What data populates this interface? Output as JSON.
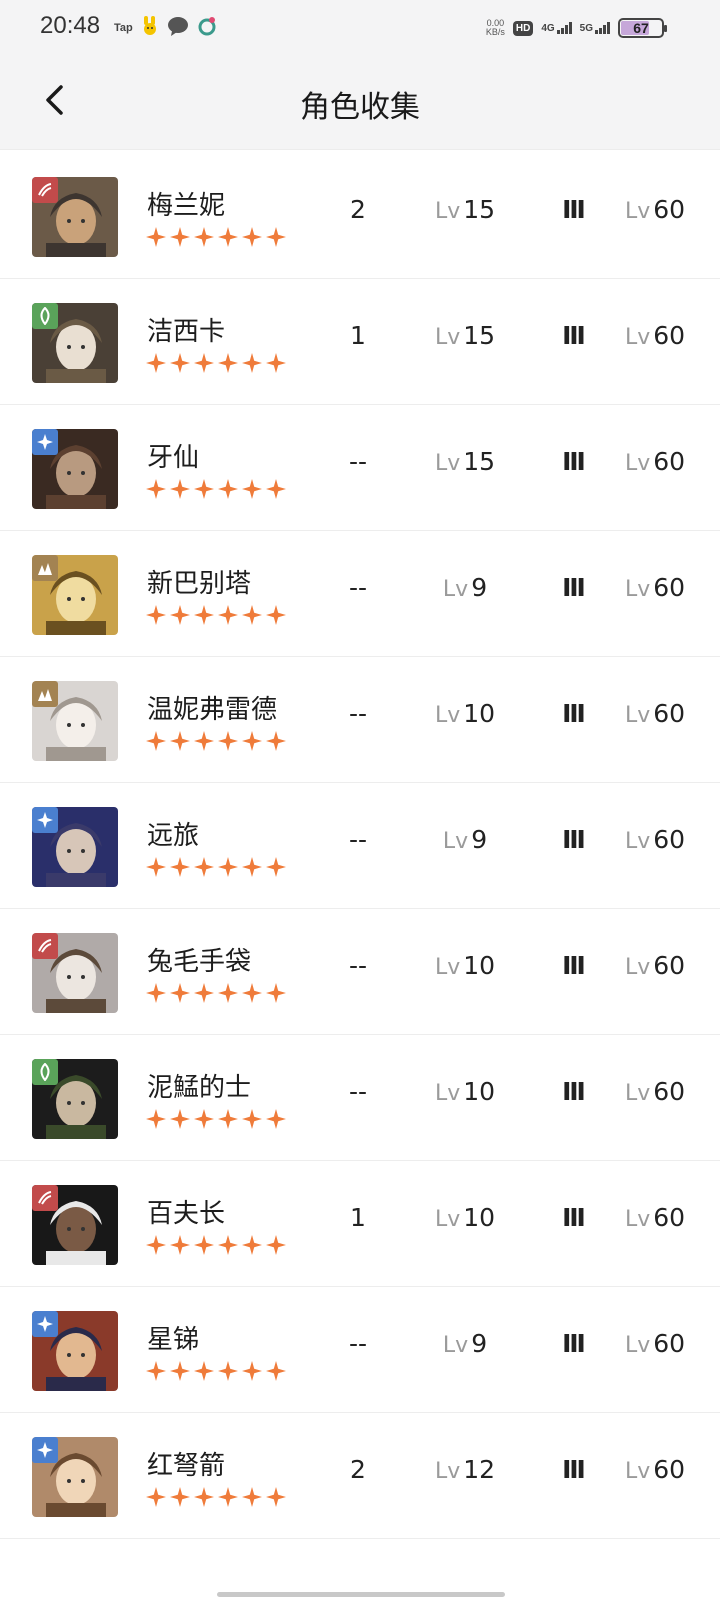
{
  "status_bar": {
    "time": "20:48",
    "tap_label": "Tap",
    "net_speed_value": "0.00",
    "net_speed_unit": "KB/s",
    "hd_label": "HD",
    "net1": "4G",
    "net2": "5G",
    "battery": "67"
  },
  "header": {
    "title": "角色收集"
  },
  "colors": {
    "star": "#ef7b3a",
    "badge_red": "#c24b4b",
    "badge_green": "#5aa35a",
    "badge_blue": "#4a7fcf",
    "badge_brown": "#a38352"
  },
  "characters": [
    {
      "name": "梅兰妮",
      "stars": 6,
      "c1": "2",
      "lv_label": "Lv",
      "level": "15",
      "rank": "Ⅲ",
      "lv2_label": "Lv",
      "max_level": "60",
      "badge": "red"
    },
    {
      "name": "洁西卡",
      "stars": 6,
      "c1": "1",
      "lv_label": "Lv",
      "level": "15",
      "rank": "Ⅲ",
      "lv2_label": "Lv",
      "max_level": "60",
      "badge": "green"
    },
    {
      "name": "牙仙",
      "stars": 6,
      "c1": "--",
      "lv_label": "Lv",
      "level": "15",
      "rank": "Ⅲ",
      "lv2_label": "Lv",
      "max_level": "60",
      "badge": "blue"
    },
    {
      "name": "新巴别塔",
      "stars": 6,
      "c1": "--",
      "lv_label": "Lv",
      "level": "9",
      "rank": "Ⅲ",
      "lv2_label": "Lv",
      "max_level": "60",
      "badge": "brown"
    },
    {
      "name": "温妮弗雷德",
      "stars": 6,
      "c1": "--",
      "lv_label": "Lv",
      "level": "10",
      "rank": "Ⅲ",
      "lv2_label": "Lv",
      "max_level": "60",
      "badge": "brown"
    },
    {
      "name": "远旅",
      "stars": 6,
      "c1": "--",
      "lv_label": "Lv",
      "level": "9",
      "rank": "Ⅲ",
      "lv2_label": "Lv",
      "max_level": "60",
      "badge": "blue"
    },
    {
      "name": "兔毛手袋",
      "stars": 6,
      "c1": "--",
      "lv_label": "Lv",
      "level": "10",
      "rank": "Ⅲ",
      "lv2_label": "Lv",
      "max_level": "60",
      "badge": "red"
    },
    {
      "name": "泥鯭的士",
      "stars": 6,
      "c1": "--",
      "lv_label": "Lv",
      "level": "10",
      "rank": "Ⅲ",
      "lv2_label": "Lv",
      "max_level": "60",
      "badge": "green"
    },
    {
      "name": "百夫长",
      "stars": 6,
      "c1": "1",
      "lv_label": "Lv",
      "level": "10",
      "rank": "Ⅲ",
      "lv2_label": "Lv",
      "max_level": "60",
      "badge": "red"
    },
    {
      "name": "星锑",
      "stars": 6,
      "c1": "--",
      "lv_label": "Lv",
      "level": "9",
      "rank": "Ⅲ",
      "lv2_label": "Lv",
      "max_level": "60",
      "badge": "blue"
    },
    {
      "name": "红弩箭",
      "stars": 6,
      "c1": "2",
      "lv_label": "Lv",
      "level": "12",
      "rank": "Ⅲ",
      "lv2_label": "Lv",
      "max_level": "60",
      "badge": "blue"
    }
  ]
}
